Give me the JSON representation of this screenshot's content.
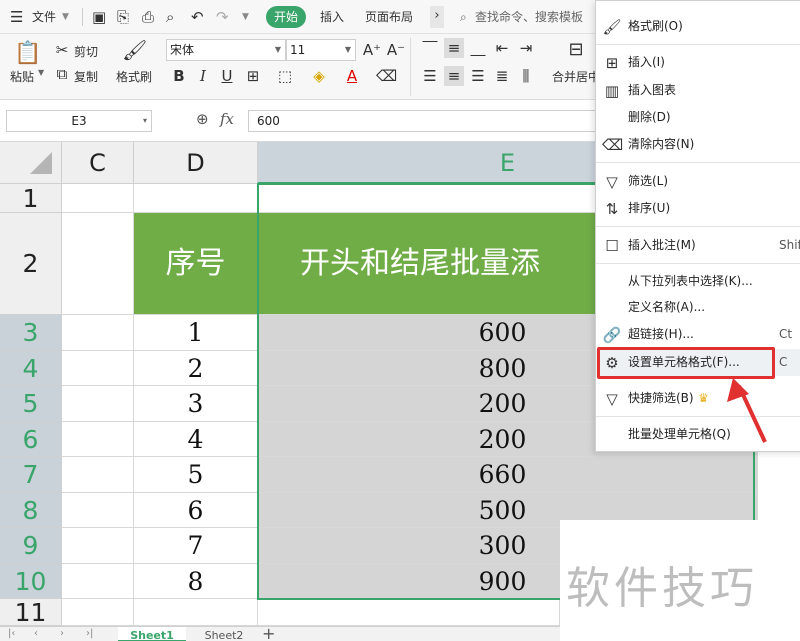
{
  "menubar": {
    "menu_icon": "hamburger-icon",
    "file_label": "文件",
    "tabs": [
      "开始",
      "插入",
      "页面布局"
    ],
    "more": "›",
    "search_placeholder": "查找命令、搜索模板",
    "accent_color": "#3aa56a"
  },
  "ribbon": {
    "paste": "粘贴",
    "cut": "剪切",
    "copy": "复制",
    "format_painter": "格式刷",
    "font_name": "宋体",
    "font_size": "11",
    "bold": "B",
    "italic": "I",
    "underline": "U",
    "merge_center": "合并居中"
  },
  "formula_bar": {
    "name_box": "E3",
    "fx": "fx",
    "formula": "600"
  },
  "grid": {
    "columns": [
      "C",
      "D",
      "E"
    ],
    "rows": [
      "1",
      "2",
      "3",
      "4",
      "5",
      "6",
      "7",
      "8",
      "9",
      "10",
      "11"
    ],
    "header_row": {
      "seq": "序号",
      "title": "开头和结尾批量添"
    },
    "header_fill": "#70ad47",
    "sequence": [
      "1",
      "2",
      "3",
      "4",
      "5",
      "6",
      "7",
      "8"
    ],
    "values": [
      "600",
      "800",
      "200",
      "200",
      "660",
      "500",
      "300",
      "900"
    ]
  },
  "context_menu": {
    "items": [
      {
        "label": "格式刷(O)",
        "icon": "brush-icon",
        "shortcut": ""
      },
      {
        "label": "插入(I)",
        "icon": "insert-icon",
        "shortcut": ""
      },
      {
        "label": "插入图表",
        "icon": "chart-icon",
        "shortcut": ""
      },
      {
        "label": "删除(D)",
        "icon": "",
        "shortcut": ""
      },
      {
        "label": "清除内容(N)",
        "icon": "eraser-icon",
        "shortcut": ""
      },
      {
        "label": "筛选(L)",
        "icon": "filter-icon",
        "shortcut": ""
      },
      {
        "label": "排序(U)",
        "icon": "sort-icon",
        "shortcut": ""
      },
      {
        "label": "插入批注(M)",
        "icon": "comment-icon",
        "shortcut": "Shif"
      },
      {
        "label": "从下拉列表中选择(K)...",
        "icon": "",
        "shortcut": ""
      },
      {
        "label": "定义名称(A)...",
        "icon": "",
        "shortcut": ""
      },
      {
        "label": "超链接(H)...",
        "icon": "link-icon",
        "shortcut": "Ct"
      },
      {
        "label": "设置单元格格式(F)...",
        "icon": "format-cells-icon",
        "shortcut": "C"
      },
      {
        "label": "快捷筛选(B)",
        "icon": "quick-filter-icon",
        "shortcut": ""
      },
      {
        "label": "批量处理单元格(Q)",
        "icon": "",
        "shortcut": ""
      }
    ],
    "highlight_color": "#e03030"
  },
  "sheets": {
    "tabs": [
      "Sheet1",
      "Sheet2"
    ],
    "add": "+"
  },
  "watermark": "软件技巧"
}
